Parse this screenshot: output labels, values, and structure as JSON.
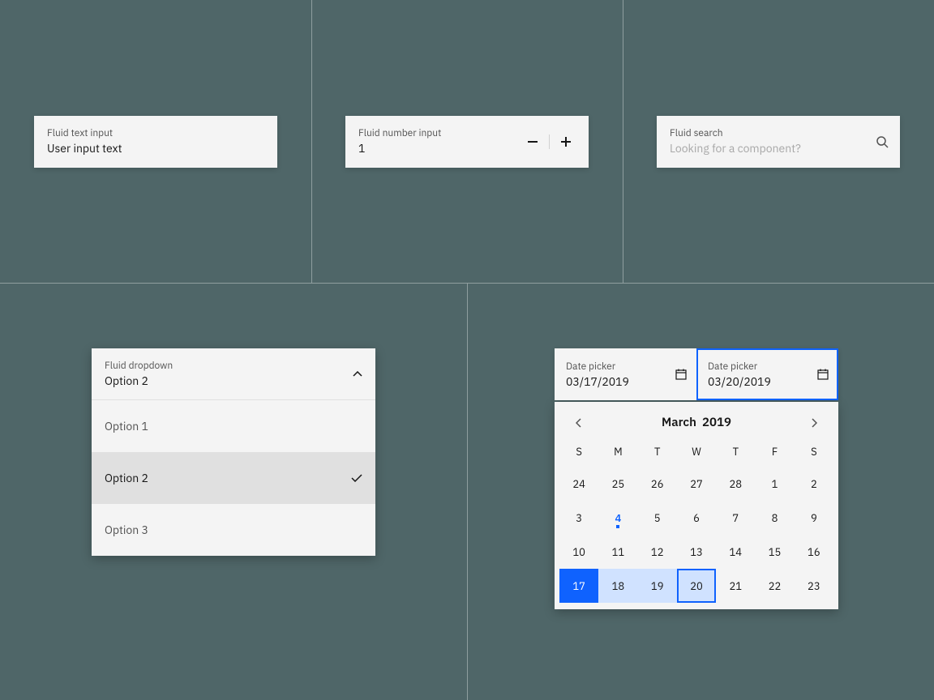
{
  "text_input": {
    "label": "Fluid text input",
    "value": "User input text"
  },
  "number_input": {
    "label": "Fluid number input",
    "value": "1"
  },
  "search": {
    "label": "Fluid search",
    "placeholder": "Looking for a component?"
  },
  "dropdown": {
    "label": "Fluid dropdown",
    "selected": "Option 2",
    "options": [
      "Option 1",
      "Option 2",
      "Option 3"
    ]
  },
  "date_picker": {
    "start_label": "Date picker",
    "start_value": "03/17/2019",
    "end_label": "Date picker",
    "end_value": "03/20/2019",
    "month": "March",
    "year": "2019",
    "dow": [
      "S",
      "M",
      "T",
      "W",
      "T",
      "F",
      "S"
    ],
    "weeks": [
      [
        {
          "d": "24",
          "o": true
        },
        {
          "d": "25",
          "o": true
        },
        {
          "d": "26",
          "o": true
        },
        {
          "d": "27",
          "o": true
        },
        {
          "d": "28",
          "o": true
        },
        {
          "d": "1"
        },
        {
          "d": "2"
        }
      ],
      [
        {
          "d": "3"
        },
        {
          "d": "4",
          "today": true
        },
        {
          "d": "5"
        },
        {
          "d": "6"
        },
        {
          "d": "7"
        },
        {
          "d": "8"
        },
        {
          "d": "9"
        }
      ],
      [
        {
          "d": "10"
        },
        {
          "d": "11"
        },
        {
          "d": "12"
        },
        {
          "d": "13"
        },
        {
          "d": "14"
        },
        {
          "d": "15"
        },
        {
          "d": "16"
        }
      ],
      [
        {
          "d": "17",
          "rs": true
        },
        {
          "d": "18",
          "ir": true
        },
        {
          "d": "19",
          "ir": true
        },
        {
          "d": "20",
          "re": true
        },
        {
          "d": "21"
        },
        {
          "d": "22"
        },
        {
          "d": "23"
        }
      ]
    ]
  }
}
